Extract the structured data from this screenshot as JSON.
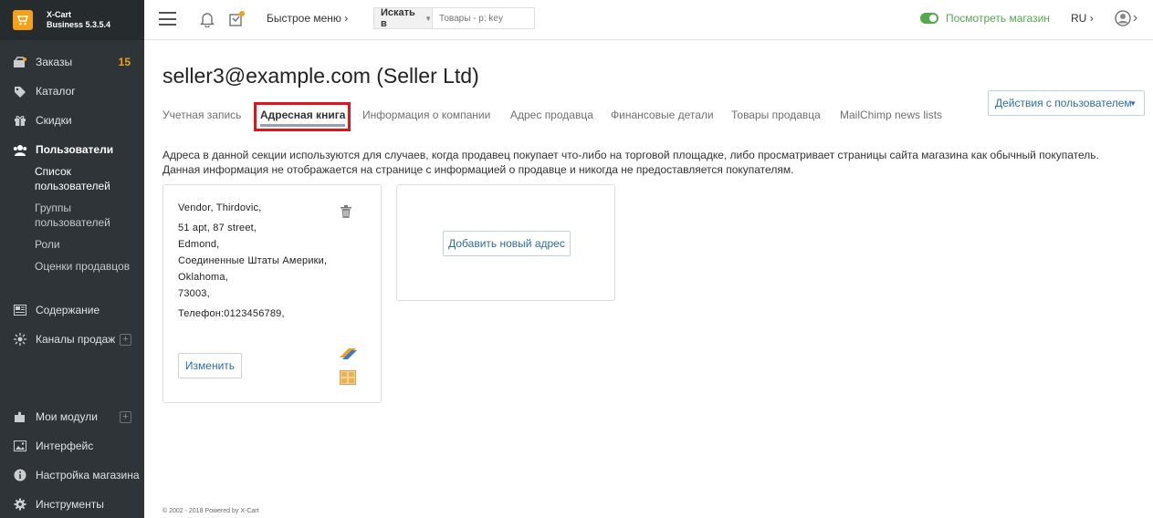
{
  "brand": {
    "name": "X-Cart",
    "edition": "Business 5.3.5.4"
  },
  "sidebar": {
    "items": [
      {
        "label": "Заказы",
        "badge": "15"
      },
      {
        "label": "Каталог"
      },
      {
        "label": "Скидки"
      },
      {
        "label": "Пользователи"
      },
      {
        "label": "Содержание"
      },
      {
        "label": "Каналы продаж"
      },
      {
        "label": "Мои модули"
      },
      {
        "label": "Интерфейс"
      },
      {
        "label": "Настройка магазина"
      },
      {
        "label": "Инструменты"
      }
    ],
    "users_sub": [
      {
        "label_1": "Список",
        "label_2": "пользователей"
      },
      {
        "label_1": "Группы",
        "label_2": "пользователей"
      },
      {
        "label_1": "Роли"
      },
      {
        "label_1": "Оценки продавцов"
      }
    ]
  },
  "topbar": {
    "quick_menu": "Быстрое меню",
    "search_scope": "Искать в",
    "search_placeholder": "Товары - p: key",
    "view_shop": "Посмотреть магазин",
    "lang": "RU"
  },
  "page": {
    "title": "seller3@example.com (Seller Ltd)",
    "tabs": [
      "Учетная запись",
      "Адресная книга",
      "Информация о компании",
      "Адрес продавца",
      "Финансовые детали",
      "Товары продавца",
      "MailChimp news lists"
    ],
    "actions_button": "Действия с пользователем",
    "info": "Адреса в данной секции используются для случаев, когда продавец покупает что-либо на торговой площадке, либо просматривает страницы сайта магазина как обычный покупатель. Данная информация не отображается на странице с информацией о продавце и никогда не предоставляется покупателям."
  },
  "address": {
    "name": "Vendor, Thirdovic,",
    "street": "51 apt, 87 street,",
    "city": "Edmond,",
    "country": "Соединенные Штаты Америки,",
    "state": "Oklahoma,",
    "zip": "73003,",
    "phone": "Телефон:0123456789,",
    "edit_button": "Изменить"
  },
  "add_address_button": "Добавить новый адрес",
  "footer": "© 2002 - 2018 Powered by X-Cart"
}
